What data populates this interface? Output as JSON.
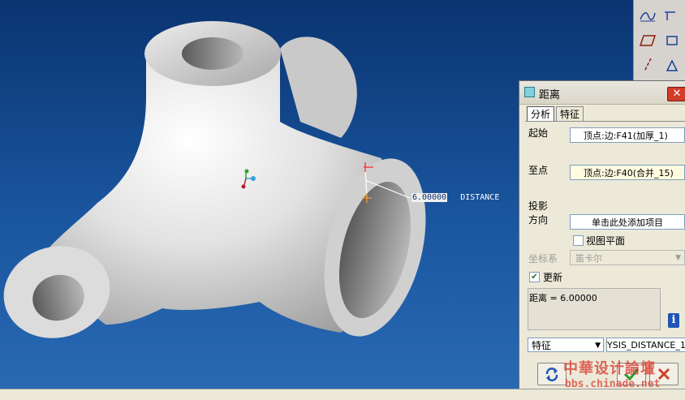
{
  "viewport": {
    "dimension": {
      "value": "6.00000",
      "label": "DISTANCE"
    }
  },
  "toolbar": {
    "icons": [
      "curve-tool-icon",
      "datum-plane-icon",
      "datum-axis-icon",
      "sketch-icon",
      "coordinate-icon",
      "analysis-icon"
    ]
  },
  "dialog": {
    "title": "距离",
    "close_label": "✕",
    "tabs": [
      {
        "label": "分析"
      },
      {
        "label": "特征"
      }
    ],
    "from": {
      "label": "起始",
      "value": "顶点:边:F41(加厚_1)"
    },
    "to": {
      "label": "至点",
      "value": "顶点:边:F40(合并_15)"
    },
    "projection": {
      "label_line1": "投影",
      "label_line2": "方向",
      "value": "单击此处添加项目"
    },
    "view_plane": {
      "label": "视图平面",
      "checked": false
    },
    "csys": {
      "label": "坐标系",
      "value": "笛卡尔"
    },
    "update": {
      "label": "更新",
      "checked": true
    },
    "result": "距离 = 6.00000",
    "feature_type": "特征",
    "feature_name": "YSIS_DISTANCE_1"
  },
  "watermark": {
    "title": "中華设计論壇",
    "url": "bbs.chinade.net"
  },
  "colors": {
    "viewport_top": "#0a3470",
    "viewport_bottom": "#2a6ab4",
    "accent_red": "#d23c2a",
    "ok_green": "#2e9a2e"
  }
}
